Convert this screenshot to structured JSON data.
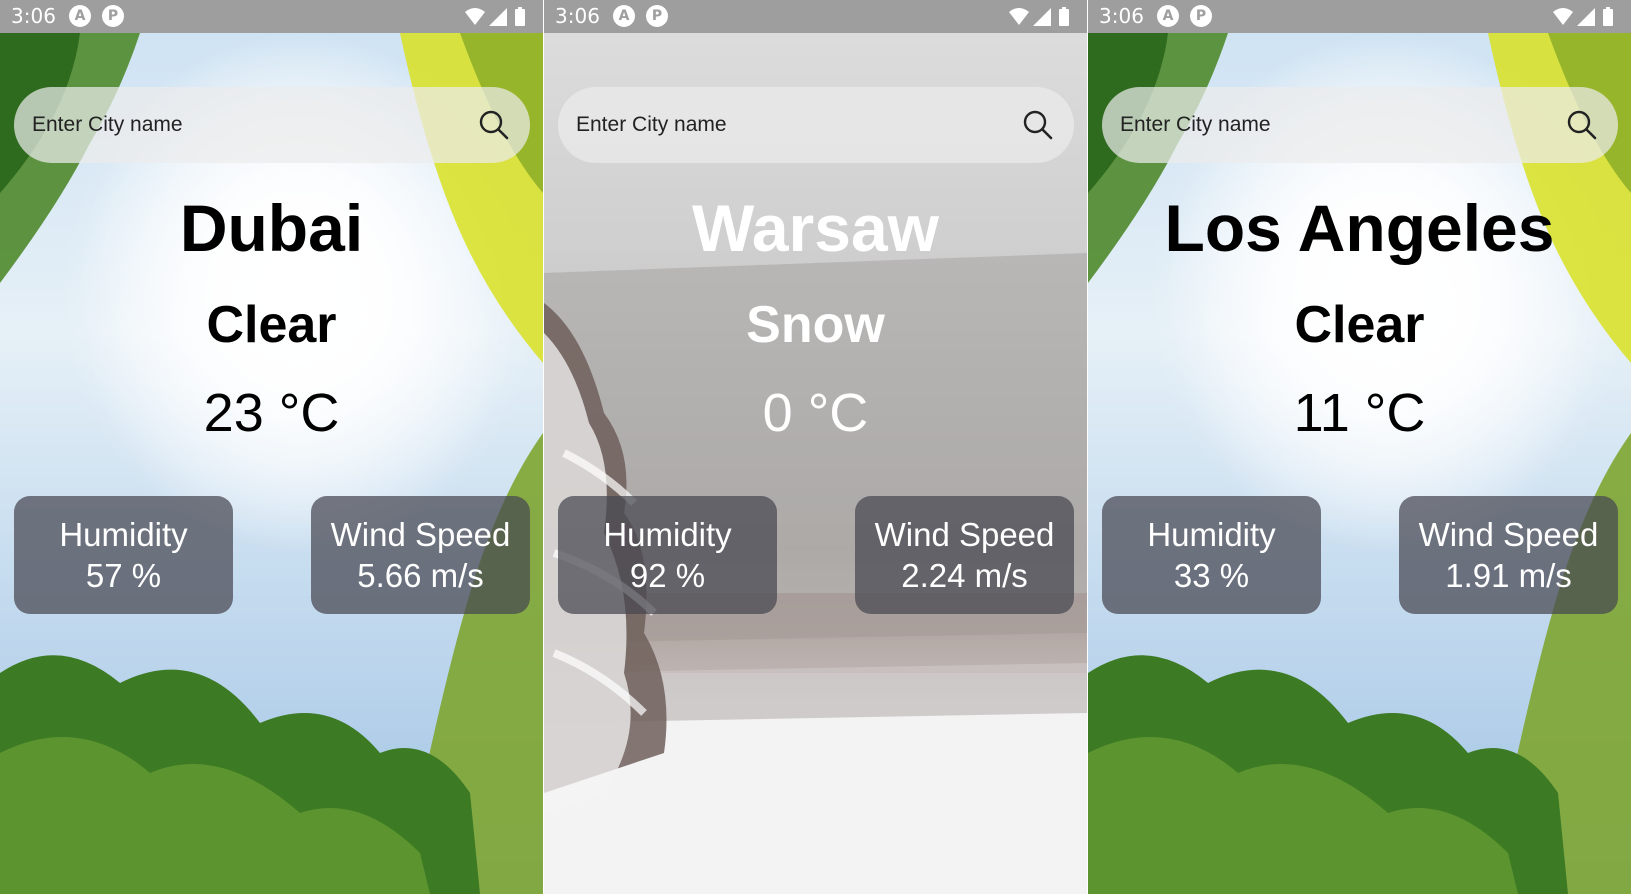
{
  "status_bar": {
    "time": "3:06"
  },
  "screens": [
    {
      "search_placeholder": "Enter City name",
      "city": "Dubai",
      "condition": "Clear",
      "temperature": "23 °C",
      "humidity_label": "Humidity",
      "humidity_value": "57 %",
      "wind_label": "Wind Speed",
      "wind_value": "5.66 m/s"
    },
    {
      "search_placeholder": "Enter City name",
      "city": "Warsaw",
      "condition": "Snow",
      "temperature": "0 °C",
      "humidity_label": "Humidity",
      "humidity_value": "92 %",
      "wind_label": "Wind Speed",
      "wind_value": "2.24 m/s"
    },
    {
      "search_placeholder": "Enter City name",
      "city": "Los Angeles",
      "condition": "Clear",
      "temperature": "11 °C",
      "humidity_label": "Humidity",
      "humidity_value": "33 %",
      "wind_label": "Wind Speed",
      "wind_value": "1.91 m/s"
    }
  ],
  "colors": {
    "status_bar": "#9e9e9e",
    "card_background": "#464650",
    "snow_text": "#ffffff",
    "clear_text": "#000000"
  },
  "icons": [
    "search-icon",
    "wifi-icon",
    "signal-icon",
    "battery-icon"
  ]
}
